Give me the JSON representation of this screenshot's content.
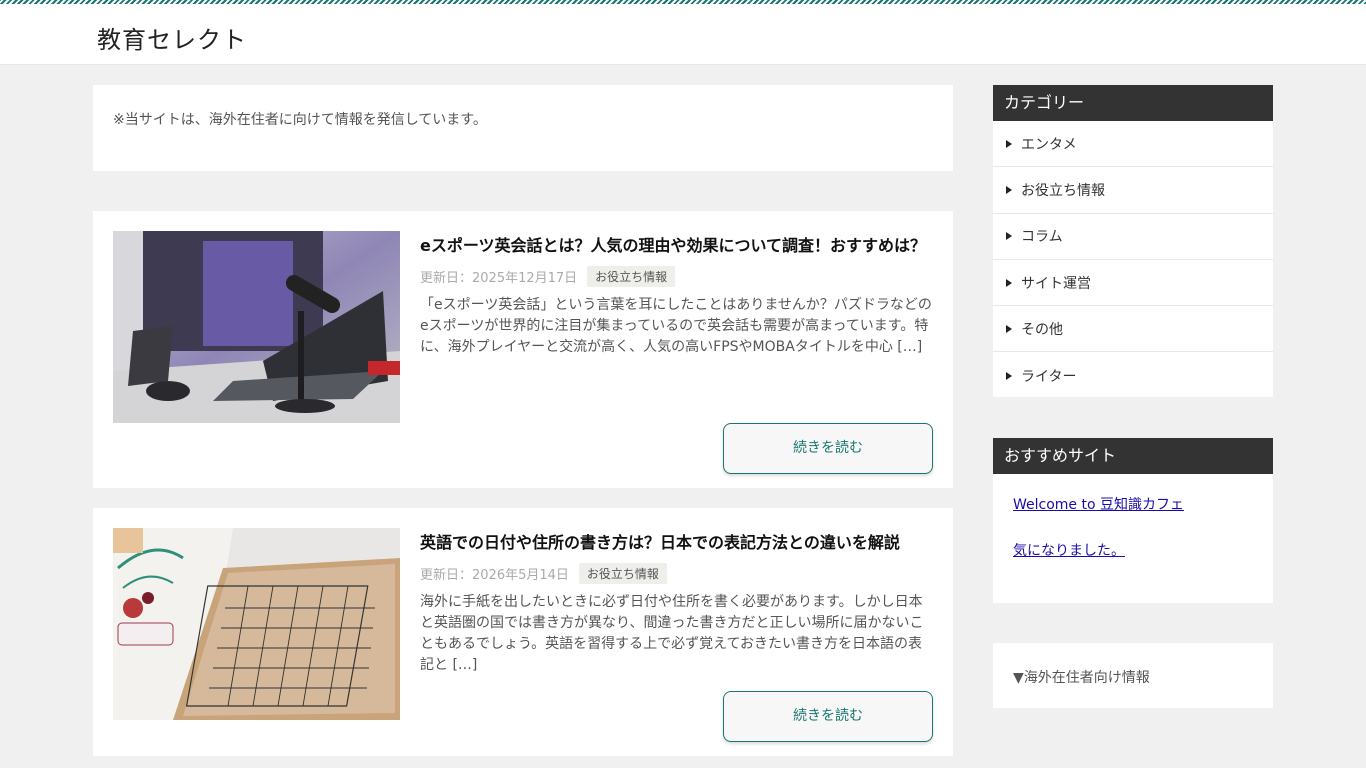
{
  "header": {
    "site_title": "教育セレクト"
  },
  "notice": {
    "text": "※当サイトは、海外在住者に向けて情報を発信しています。"
  },
  "articles": [
    {
      "title": "eスポーツ英会話とは？人気の理由や効果について調査！おすすめは？",
      "date": "更新日：2025年12月17日",
      "tag": "お役立ち情報",
      "excerpt": "「eスポーツ英会話」という言葉を耳にしたことはありませんか？パズドラなどのeスポーツが世界的に注目が集まっているので英会話も需要が高まっています。特に、海外プレイヤーと交流が高く、人気の高いFPSやMOBAタイトルを中心 […]",
      "read_more": "続きを読む"
    },
    {
      "title": "英語での日付や住所の書き方は？日本での表記方法との違いを解説",
      "date": "更新日：2026年5月14日",
      "tag": "お役立ち情報",
      "excerpt": "海外に手紙を出したいときに必ず日付や住所を書く必要があります。しかし日本と英語圏の国では書き方が異なり、間違った書き方だと正しい場所に届かないこともあるでしょう。英語を習得する上で必ず覚えておきたい書き方を日本語の表記と […]",
      "read_more": "続きを読む"
    }
  ],
  "sidebar": {
    "categories": {
      "heading": "カテゴリー",
      "items": [
        "エンタメ",
        "お役立ち情報",
        "コラム",
        "サイト運営",
        "その他",
        "ライター"
      ]
    },
    "recommended": {
      "heading": "おすすめサイト",
      "links": [
        "Welcome to 豆知識カフェ",
        "気になりました。"
      ]
    },
    "info": {
      "text": "▼海外在住者向け情報"
    }
  },
  "colors": {
    "accent": "#19776f",
    "widget_head": "#333333",
    "link": "#1a0dab",
    "background": "#f0f0f0"
  }
}
